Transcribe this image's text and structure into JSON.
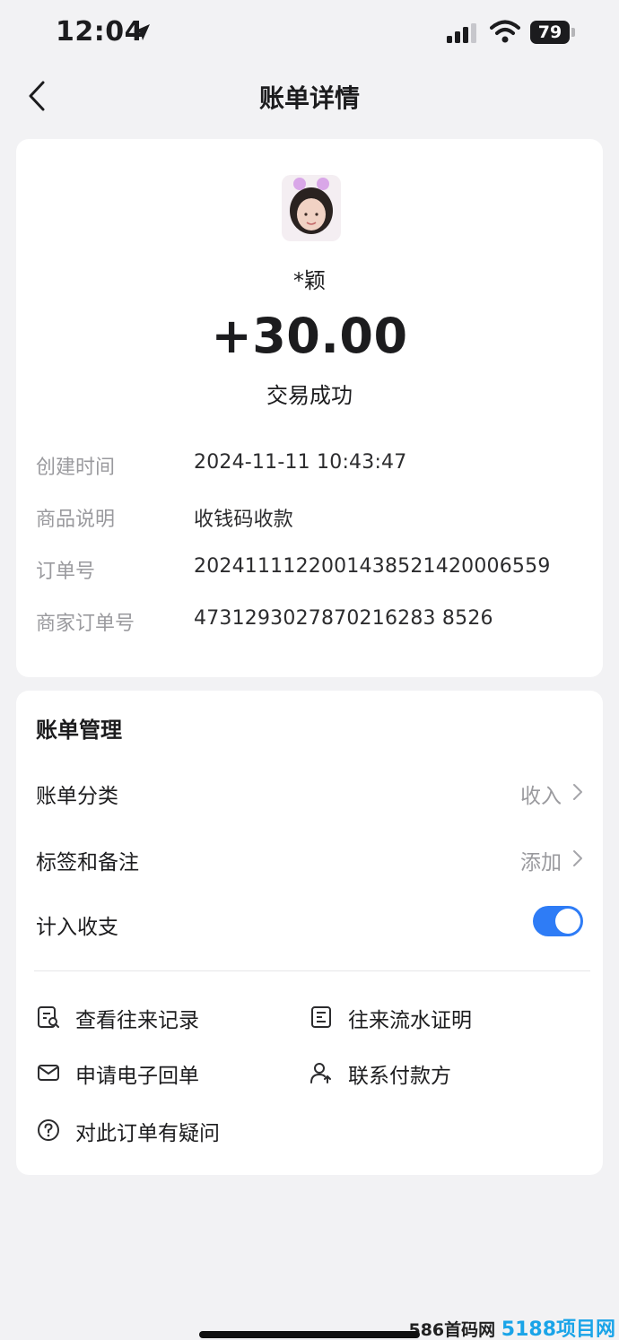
{
  "status_bar": {
    "time": "12:04",
    "battery": "79"
  },
  "nav": {
    "title": "账单详情"
  },
  "transaction": {
    "payer_name": "*颖",
    "amount": "+30.00",
    "status": "交易成功"
  },
  "details": [
    {
      "label": "创建时间",
      "value": "2024-11-11 10:43:47"
    },
    {
      "label": "商品说明",
      "value": "收钱码收款"
    },
    {
      "label": "订单号",
      "value": "2024111122001438521420006559"
    },
    {
      "label": "商家订单号",
      "value": "4731293027870216283 8526"
    }
  ],
  "management": {
    "title": "账单管理",
    "category_label": "账单分类",
    "category_value": "收入",
    "tags_label": "标签和备注",
    "tags_value": "添加",
    "count_label": "计入收支",
    "count_enabled": true
  },
  "actions": {
    "view_records": "查看往来记录",
    "flow_proof": "往来流水证明",
    "e_receipt": "申请电子回单",
    "contact_payer": "联系付款方",
    "question": "对此订单有疑问"
  },
  "watermark": {
    "text": "586首码网",
    "logo": "5188项目网"
  },
  "colors": {
    "accent": "#2e7cf6",
    "background": "#f2f2f4"
  }
}
